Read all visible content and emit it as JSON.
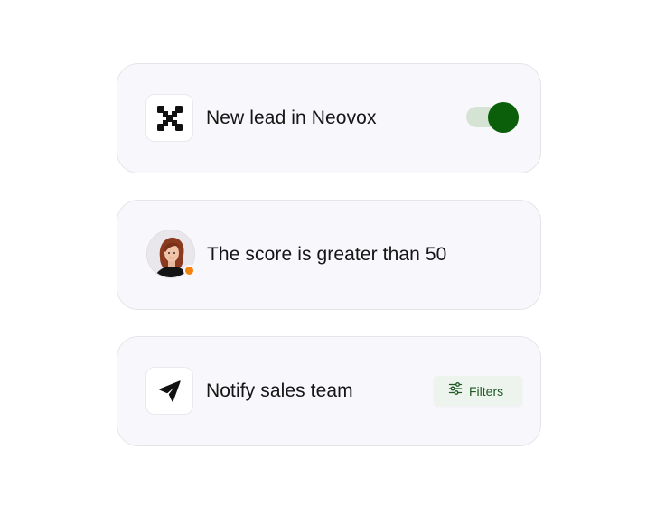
{
  "colors": {
    "card_bg": "#f8f7fb",
    "card_border": "#e6e4ea",
    "accent_green": "#0b5f0b",
    "toggle_track": "#d5e3d5",
    "status_orange": "#f5820b",
    "filters_bg": "#edf3ed",
    "filters_text": "#1f5a24"
  },
  "steps": [
    {
      "icon": "neovox-logo-icon",
      "label": "New lead in Neovox",
      "toggle_on": true
    },
    {
      "icon": "avatar",
      "label": "The score is greater than 50",
      "status": "orange-dot"
    },
    {
      "icon": "send-icon",
      "label": "Notify sales team",
      "button_label": "Filters",
      "button_icon": "sliders-icon"
    }
  ]
}
